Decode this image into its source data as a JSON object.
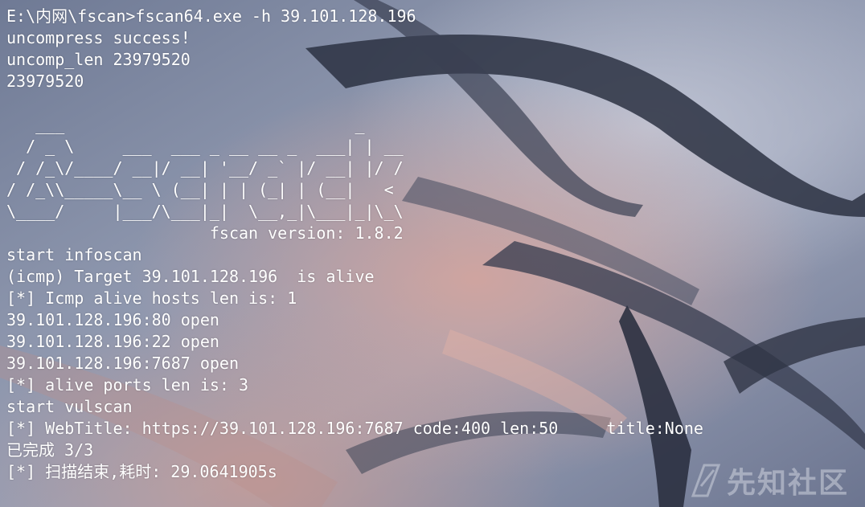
{
  "terminal": {
    "prompt_line": "E:\\内网\\fscan>fscan64.exe -h 39.101.128.196",
    "pre_banner": [
      "uncompress success!",
      "uncomp_len 23979520",
      "23979520",
      ""
    ],
    "banner": [
      "   ___                              _    ",
      "  / _ \\     ___  ___ _ __ __ _  ___| | __ ",
      " / /_\\/____/ __|/ __| '__/ _` |/ __| |/ / ",
      "/ /_\\\\_____\\__ \\ (__| | | (_| | (__|   <  ",
      "\\____/     |___/\\___|_|  \\__,_|\\___|_|\\_\\ ",
      "                     fscan version: 1.8.2"
    ],
    "output": [
      "start infoscan",
      "(icmp) Target 39.101.128.196  is alive",
      "[*] Icmp alive hosts len is: 1",
      "39.101.128.196:80 open",
      "39.101.128.196:22 open",
      "39.101.128.196:7687 open",
      "[*] alive ports len is: 3",
      "start vulscan",
      "[*] WebTitle: https://39.101.128.196:7687 code:400 len:50     title:None",
      "已完成 3/3",
      "[*] 扫描结束,耗时: 29.0641905s"
    ]
  },
  "watermark": {
    "text": "先知社区",
    "icon": "xianzhi-logo-icon"
  },
  "colors": {
    "text": "#ffffff",
    "background": "#7d879f"
  }
}
